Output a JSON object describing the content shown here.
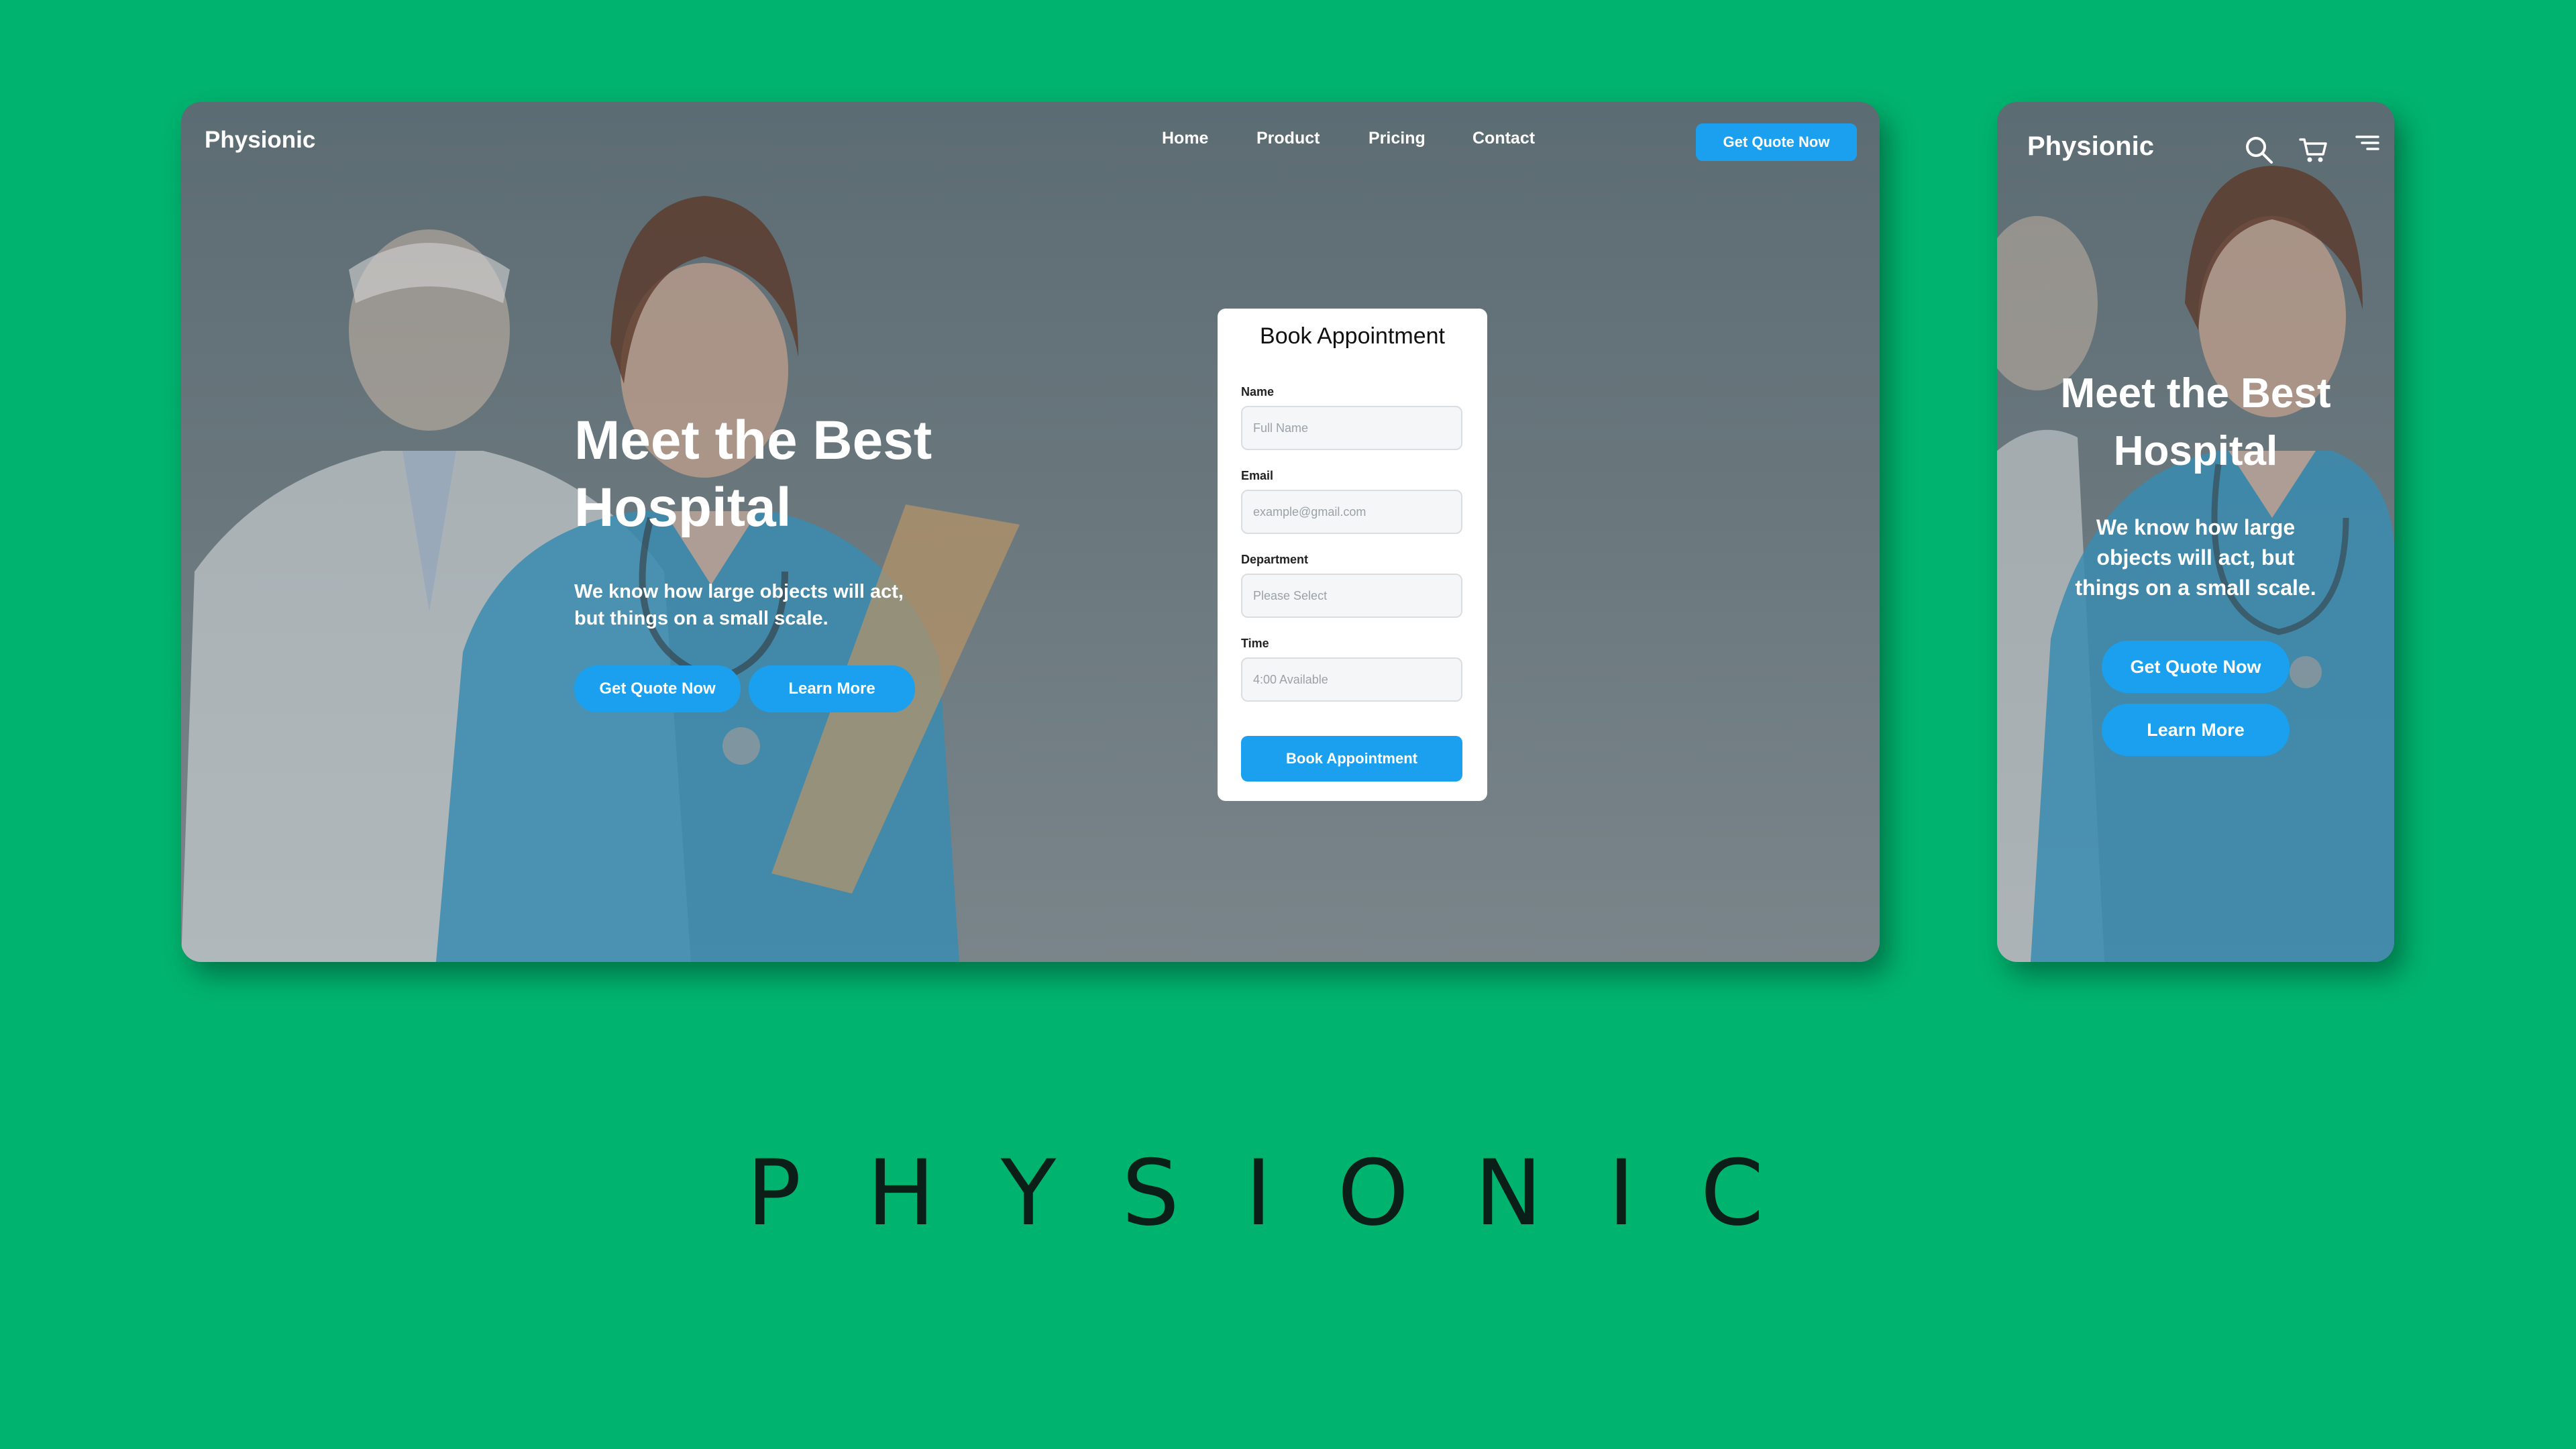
{
  "desktop": {
    "logo": "Physionic",
    "nav": [
      {
        "label": "Home"
      },
      {
        "label": "Product"
      },
      {
        "label": "Pricing"
      },
      {
        "label": "Contact"
      }
    ],
    "nav_cta": "Get Quote Now",
    "hero_title_line1": "Meet the Best",
    "hero_title_line2": "Hospital",
    "hero_sub_line1": "We know how large objects will act,",
    "hero_sub_line2": "but things on a small scale.",
    "primary_button": "Get Quote Now",
    "secondary_button": "Learn More"
  },
  "booking": {
    "title": "Book Appointment",
    "fields": [
      {
        "label": "Name",
        "placeholder": "Full Name"
      },
      {
        "label": "Email",
        "placeholder": "example@gmail.com"
      },
      {
        "label": "Department",
        "placeholder": "Please Select"
      },
      {
        "label": "Time",
        "placeholder": "4:00 Available"
      }
    ],
    "submit": "Book Appointment"
  },
  "mobile": {
    "logo": "Physionic",
    "hero_title_line1": "Meet the Best",
    "hero_title_line2": "Hospital",
    "hero_sub_line1": "We know how large",
    "hero_sub_line2": "objects will act, but",
    "hero_sub_line3": "things on a small scale.",
    "primary_button": "Get Quote Now",
    "secondary_button": "Learn More",
    "icons": [
      "search-icon",
      "cart-icon",
      "menu-icon"
    ]
  },
  "brand_wordmark": "PHYSIONIC",
  "colors": {
    "background": "#00b36f",
    "accent": "#1aa0ee",
    "overlay": "#5c6c73"
  }
}
